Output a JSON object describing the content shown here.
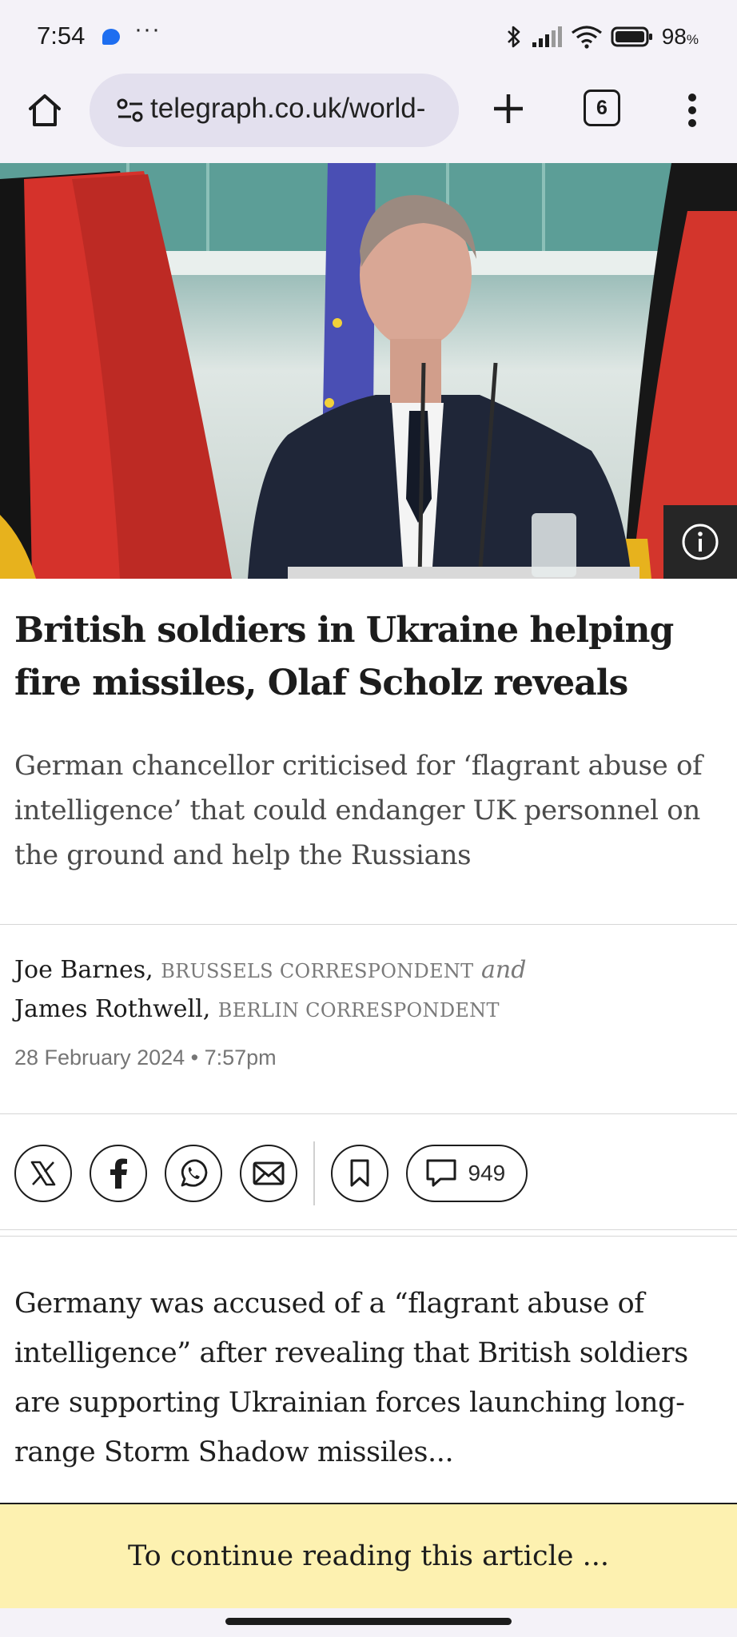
{
  "status_bar": {
    "time": "7:54",
    "overflow": "···",
    "battery": "98",
    "battery_unit": "%",
    "icons": [
      "messages-icon",
      "bluetooth-icon",
      "signal-icon",
      "wifi-icon",
      "battery-icon"
    ]
  },
  "browser": {
    "url": "telegraph.co.uk/world-",
    "tab_count": "6",
    "icons": [
      "home-icon",
      "site-settings-icon",
      "new-tab-icon",
      "tab-switcher-icon",
      "more-menu-icon"
    ]
  },
  "article": {
    "headline": "British soldiers in Ukraine helping fire missiles, Olaf Scholz reveals",
    "standfirst": "German chancellor criticised for ‘flagrant abuse of intelligence’ that could endanger UK personnel on the ground and help the Russians",
    "authors": [
      {
        "name": "Joe Barnes,",
        "role": "BRUSSELS CORRESPONDENT"
      },
      {
        "name": "James Rothwell,",
        "role": "BERLIN CORRESPONDENT"
      }
    ],
    "author_conjunction": "and",
    "date": "28 February 2024 • 7:57pm",
    "comments_count": "949",
    "body": "Germany was accused of a “flagrant abuse of intelligence” after revealing that British soldiers are supporting Ukrainian forces launching long-range Storm Shadow missiles..."
  },
  "share_icons": [
    "x-icon",
    "facebook-icon",
    "whatsapp-icon",
    "email-icon",
    "bookmark-icon",
    "comment-icon"
  ],
  "paywall": {
    "text": "To continue reading this article ..."
  },
  "colors": {
    "paywall_bg": "#fdf1b0",
    "chrome_bg": "#f4f2f8",
    "url_pill": "#e3e0ee",
    "status_accent": "#1e6ef0"
  }
}
